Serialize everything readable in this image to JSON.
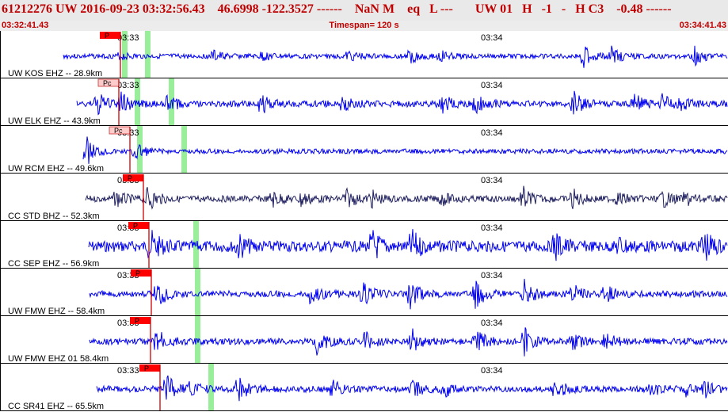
{
  "header": {
    "title": "61212276 UW 2016-09-23 03:32:56.43    46.6998 -122.3527 ------    NaN M    eq   L ---       UW 01   H   -1   -   H C3    -0.48 ------",
    "start_time": "03:32:41.43",
    "timespan": "Timespan= 120 s",
    "end_time": "03:34:41.43"
  },
  "colors": {
    "trace": "#0000ee",
    "trace_dark": "#202060",
    "pick_red": "#ff0000",
    "pick_pink": "#ffcccc",
    "green_bar": "#99ee99",
    "title_text": "#c00000"
  },
  "channels": [
    {
      "label": "UW KOS EHZ -- 28.9km",
      "minute1": "03:33",
      "minute2": "03:34",
      "pick": "P",
      "pick_style": "red"
    },
    {
      "label": "UW ELK EHZ -- 43.9km",
      "minute1": "03:33",
      "minute2": "03:34",
      "pick": "Pc",
      "pick_style": "pink"
    },
    {
      "label": "UW RCM EHZ -- 49.6km",
      "minute1": "03:33",
      "minute2": "03:34",
      "pick": "Pc",
      "pick_style": "pink"
    },
    {
      "label": "CC STD BHZ -- 52.3km",
      "minute1": "03:33",
      "minute2": "03:34",
      "pick": "P",
      "pick_style": "red"
    },
    {
      "label": "CC SEP EHZ -- 56.9km",
      "minute1": "03:33",
      "minute2": "03:34",
      "pick": "P",
      "pick_style": "red"
    },
    {
      "label": "UW FMW EHZ -- 58.4km",
      "minute1": "03:33",
      "minute2": "03:34",
      "pick": "P",
      "pick_style": "red"
    },
    {
      "label": "UW FMW EHZ 01 58.4km",
      "minute1": "03:33",
      "minute2": "03:34",
      "pick": "P",
      "pick_style": "red"
    },
    {
      "label": "CC SR41 EHZ -- 65.5km",
      "minute1": "03:33",
      "minute2": "03:34",
      "pick": "P",
      "pick_style": "red"
    }
  ]
}
